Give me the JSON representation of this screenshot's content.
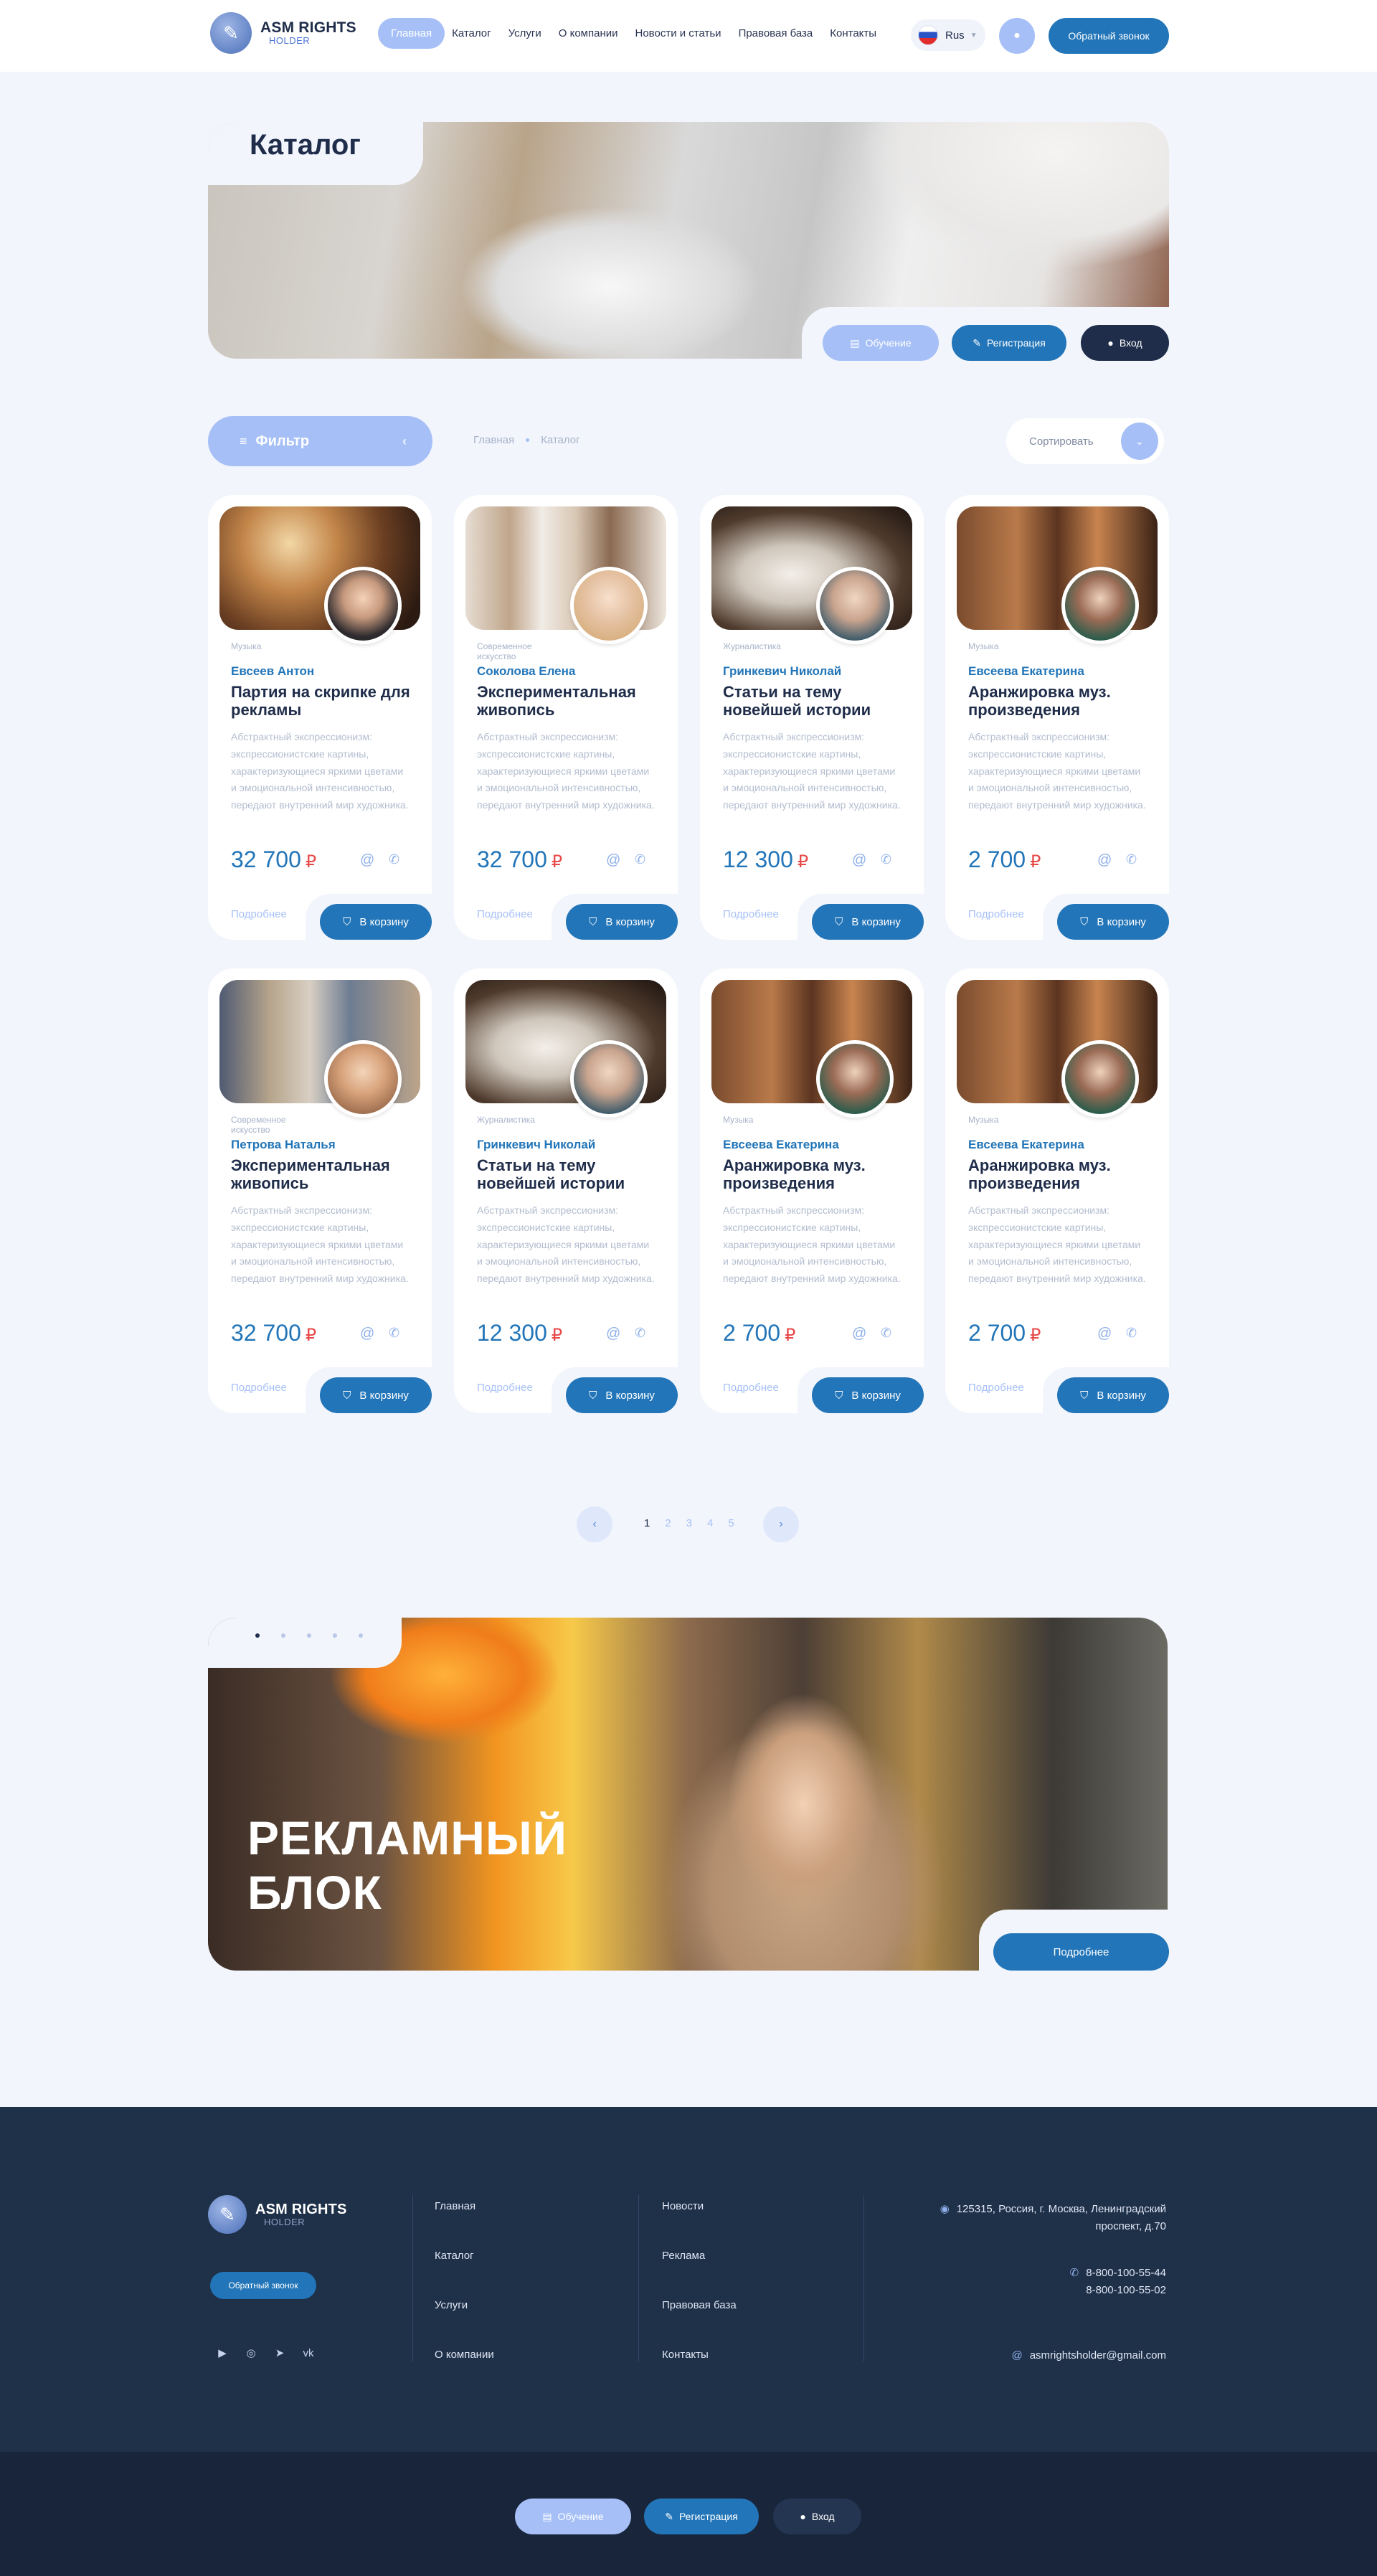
{
  "header": {
    "logo_title": "ASM RIGHTS",
    "logo_sub": "HOLDER",
    "nav": [
      "Главная",
      "Каталог",
      "Услуги",
      "О компании",
      "Новости и статьи",
      "Правовая база",
      "Контакты"
    ],
    "lang": "Rus",
    "callback": "Обратный звонок"
  },
  "hero": {
    "title": "Каталог",
    "btn_learn": "Обучение",
    "btn_reg": "Регистрация",
    "btn_login": "Вход"
  },
  "toolbar": {
    "filter": "Фильтр",
    "breadcrumb": [
      "Главная",
      "Каталог"
    ],
    "sort": "Сортировать"
  },
  "cards": [
    {
      "category": "Музыка",
      "author": "Евсеев Антон",
      "title": "Партия на скрипке для рекламы",
      "price": "32 700"
    },
    {
      "category": "Современное искусство",
      "author": "Соколова Елена",
      "title": "Экспериментальная живопись",
      "price": "32 700"
    },
    {
      "category": "Журналистика",
      "author": "Гринкевич Николай",
      "title": "Статьи на тему новейшей истории",
      "price": "12 300"
    },
    {
      "category": "Музыка",
      "author": "Евсеева Екатерина",
      "title": "Аранжировка муз. произведения",
      "price": "2 700"
    },
    {
      "category": "Современное искусство",
      "author": "Петрова Наталья",
      "title": "Экспериментальная живопись",
      "price": "32 700"
    },
    {
      "category": "Журналистика",
      "author": "Гринкевич Николай",
      "title": "Статьи на тему новейшей истории",
      "price": "12 300"
    },
    {
      "category": "Музыка",
      "author": "Евсеева Екатерина",
      "title": "Аранжировка муз. произведения",
      "price": "2 700"
    },
    {
      "category": "Музыка",
      "author": "Евсеева Екатерина",
      "title": "Аранжировка муз. произведения",
      "price": "2 700"
    }
  ],
  "card_common": {
    "description": "Абстрактный экспрессионизм: экспрессионистские картины, характеризующиеся яркими цветами и эмоциональной интенсивностью, передают внутренний мир художника.",
    "currency": "₽",
    "more": "Подробнее",
    "cart": "В корзину"
  },
  "pagination": {
    "pages": [
      "1",
      "2",
      "3",
      "4",
      "5"
    ],
    "current": "1"
  },
  "ad": {
    "title_line1": "РЕКЛАМНЫЙ",
    "title_line2": "БЛОК",
    "more": "Подробнее"
  },
  "footer": {
    "logo_title": "ASM RIGHTS",
    "logo_sub": "HOLDER",
    "callback": "Обратный звонок",
    "col1": [
      "Главная",
      "Каталог",
      "Услуги",
      "О компании"
    ],
    "col2": [
      "Новости",
      "Реклама",
      "Правовая база",
      "Контакты"
    ],
    "address_line1": "125315, Россия, г. Москва, Ленинградский",
    "address_line2": "проспект, д.70",
    "phone1": "8-800-100-55-44",
    "phone2": "8-800-100-55-02",
    "email": "asmrightsholder@gmail.com",
    "btn_learn": "Обучение",
    "btn_reg": "Регистрация",
    "btn_login": "Вход"
  },
  "colors": {
    "accent": "#2275b8",
    "light_accent": "#a6c0f7",
    "dark": "#1f2d4a",
    "ruble": "#e84a4a"
  }
}
